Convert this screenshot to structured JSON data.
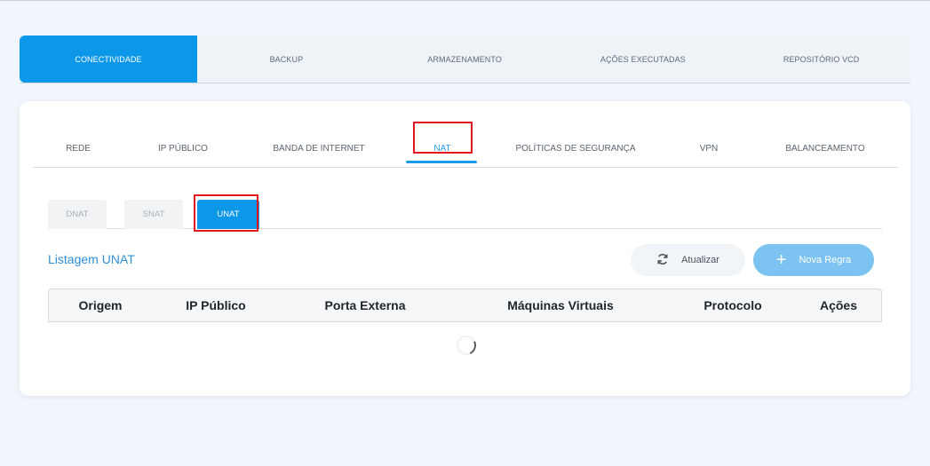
{
  "top_tabs": [
    {
      "label": "CONECTIVIDADE",
      "active": true
    },
    {
      "label": "BACKUP"
    },
    {
      "label": "ARMAZENAMENTO"
    },
    {
      "label": "AÇÕES EXECUTADAS"
    },
    {
      "label": "REPOSITÓRIO VCD"
    }
  ],
  "sub_tabs": [
    {
      "label": "REDE"
    },
    {
      "label": "IP PÚBLICO"
    },
    {
      "label": "BANDA DE INTERNET"
    },
    {
      "label": "NAT",
      "active": true
    },
    {
      "label": "POLÍTICAS DE SEGURANÇA"
    },
    {
      "label": "VPN"
    },
    {
      "label": "BALANCEAMENTO"
    }
  ],
  "nat_tabs": [
    {
      "label": "DNAT"
    },
    {
      "label": "SNAT"
    },
    {
      "label": "UNAT",
      "active": true
    }
  ],
  "list": {
    "title": "Listagem UNAT",
    "refresh_label": "Atualizar",
    "new_rule_label": "Nova Regra"
  },
  "table": {
    "columns": [
      "Origem",
      "IP Público",
      "Porta Externa",
      "Máquinas Virtuais",
      "Protocolo",
      "Ações"
    ]
  },
  "colors": {
    "accent": "#0d97e8",
    "highlight": "#e3181f"
  },
  "icons": {
    "refresh": "refresh-icon",
    "add": "plus-icon",
    "loading": "loading-spinner-icon"
  }
}
